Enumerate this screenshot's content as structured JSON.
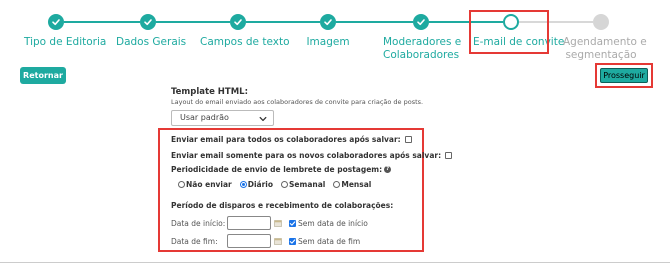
{
  "stepper": {
    "steps": [
      {
        "label": "Tipo de Editoria",
        "state": "done"
      },
      {
        "label": "Dados Gerais",
        "state": "done"
      },
      {
        "label": "Campos de texto",
        "state": "done"
      },
      {
        "label": "Imagem",
        "state": "done"
      },
      {
        "label_line1": "Moderadores e",
        "label_line2": "Colaboradores",
        "state": "done"
      },
      {
        "label": "E-mail de convite",
        "state": "current"
      },
      {
        "label_line1": "Agendamento e",
        "label_line2": "segmentação",
        "state": "pending"
      }
    ]
  },
  "buttons": {
    "return_label": "Retornar",
    "proceed_label": "Prosseguir"
  },
  "template": {
    "title": "Template HTML:",
    "description": "Layout do email enviado aos colaboradores de convite para criação de posts.",
    "selected": "Usar padrão"
  },
  "options": {
    "send_all": "Enviar email para todos os colaboradores após salvar:",
    "send_new": "Enviar email somente para os novos colaboradores após salvar:",
    "reminder_title": "Periodicidade de envio de lembrete de postagem:",
    "help_glyph": "?"
  },
  "frequency": {
    "options": [
      "Não enviar",
      "Diário",
      "Semanal",
      "Mensal"
    ],
    "selected": "Diário"
  },
  "period": {
    "title": "Período de disparos e recebimento de colaborações:",
    "start_label": "Data de início:",
    "start_checkbox": "Sem data de início",
    "end_label": "Data de fim:",
    "end_checkbox": "Sem data de fim"
  },
  "colors": {
    "accent": "#1eaaa0",
    "highlight": "#e53935",
    "checkbox": "#1a73e8",
    "pending": "#d6d6d6"
  }
}
